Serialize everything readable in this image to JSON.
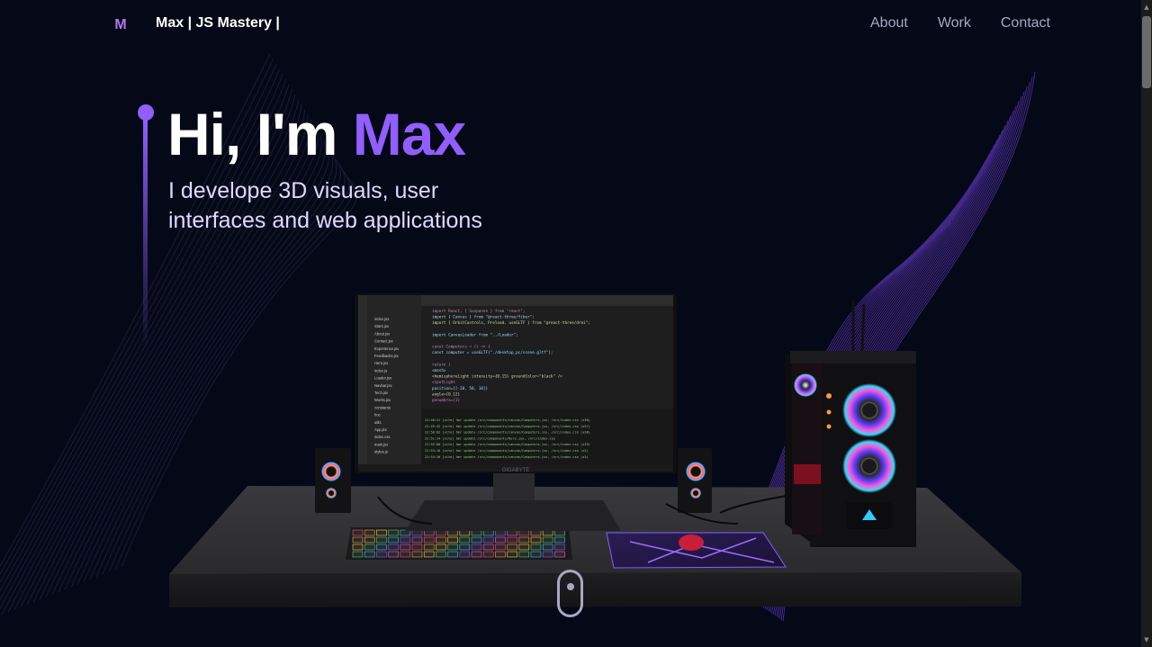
{
  "nav": {
    "logo": "M",
    "brand": "Max  | JS Mastery |",
    "links": [
      {
        "label": "About"
      },
      {
        "label": "Work"
      },
      {
        "label": "Contact"
      }
    ]
  },
  "hero": {
    "title_prefix": "Hi, I'm ",
    "title_name": "Max",
    "subtitle_line1": "I develope 3D visuals, user",
    "subtitle_line2": "interfaces and web applications"
  },
  "scene": {
    "monitor_brand": "GIGABYTE",
    "code_lines": [
      "import React, { Suspense } from \"react\";",
      "import { Canvas } from \"@react-three/fiber\";",
      "import { OrbitControls, Preload, useGLTF } from \"@react-three/drei\";",
      "",
      "import CanvasLoader from \"../Loader\";",
      "",
      "const Computers = () => {",
      "  const computer = useGLTF(\"./desktop_pc/scene.gltf\");",
      "",
      "  return (",
      "    <mesh>",
      "      <hemisphereLight intensity={0.15} groundColor=\"black\" />",
      "      <spotLight",
      "        position={[-20, 50, 10]}",
      "        angle={0.12}",
      "        penumbra={1}"
    ],
    "explorer_items": [
      "index.jsx",
      "Stars.jsx",
      "About.jsx",
      "Contact.jsx",
      "Experience.jsx",
      "Feedbacks.jsx",
      "Hero.jsx",
      "index.js",
      "Loader.jsx",
      "Navbar.jsx",
      "Tech.jsx",
      "Works.jsx",
      "constants",
      "hoc",
      "utils",
      "App.jsx",
      "index.css",
      "main.jsx",
      "styles.js"
    ],
    "terminal_lines": [
      "22:48:41 [vite] hmr update /src/components/canvas/Computers.jsx, /src/index.css (x36)",
      "22:49:42 [vite] hmr update /src/components/canvas/Computers.jsx, /src/index.css (x37)",
      "22:50:02 [vite] hmr update /src/components/canvas/Computers.jsx, /src/index.css (x38)",
      "22:51:24 [vite] hmr update /src/components/Hero.jsx, /src/index.css",
      "22:52:06 [vite] hmr update /src/components/canvas/Computers.jsx, /src/index.css (x39)",
      "22:53:16 [vite] hmr update /src/components/canvas/Computers.jsx, /src/index.css (x2)",
      "22:54:20 [vite] hmr update /src/components/canvas/Computers.jsx, /src/index.css (x3)"
    ]
  },
  "colors": {
    "background": "#050816",
    "accent": "#915eff",
    "secondary_text": "#aaa6c3"
  }
}
